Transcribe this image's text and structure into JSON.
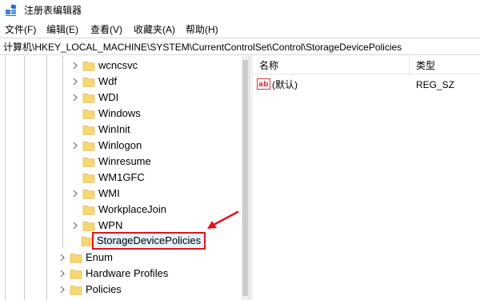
{
  "window": {
    "title": "注册表编辑器"
  },
  "menu": [
    "文件(F)",
    "编辑(E)",
    "查看(V)",
    "收藏夹(A)",
    "帮助(H)"
  ],
  "address": "计算机\\HKEY_LOCAL_MACHINE\\SYSTEM\\CurrentControlSet\\Control\\StorageDevicePolicies",
  "tree": {
    "control_children": [
      "wcncsvc",
      "Wdf",
      "WDI",
      "Windows",
      "WinInit",
      "Winlogon",
      "Winresume",
      "WM1GFC",
      "WMI",
      "WorkplaceJoin",
      "WPN"
    ],
    "selected": "StorageDevicePolicies",
    "siblings": [
      "Enum",
      "Hardware Profiles",
      "Policies"
    ]
  },
  "list": {
    "columns": {
      "name": "名称",
      "type": "类型"
    },
    "rows": [
      {
        "name": "(默认)",
        "type": "REG_SZ",
        "icon": "string-value-icon"
      }
    ]
  },
  "colors": {
    "annotation": "#e0141e",
    "folder": "#f7d774",
    "selection": "#e5f1fb"
  }
}
